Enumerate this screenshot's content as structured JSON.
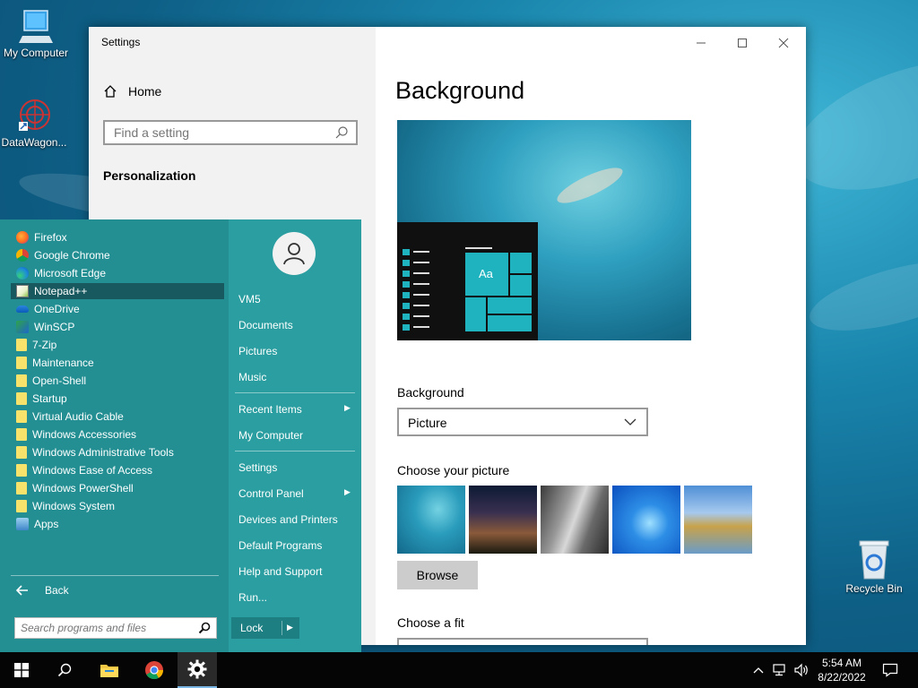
{
  "desktop": {
    "icons": [
      {
        "label": "My Computer"
      },
      {
        "label": "DataWagon..."
      },
      {
        "label": "Recycle Bin"
      }
    ]
  },
  "settings": {
    "window_title": "Settings",
    "home_label": "Home",
    "search_placeholder": "Find a setting",
    "section_title": "Personalization",
    "page_title": "Background",
    "background_label": "Background",
    "background_value": "Picture",
    "choose_picture_label": "Choose your picture",
    "browse_label": "Browse",
    "choose_fit_label": "Choose a fit",
    "preview_sample_text": "Aa"
  },
  "start_menu": {
    "programs": [
      {
        "label": "Firefox",
        "icon": "firefox-icon"
      },
      {
        "label": "Google Chrome",
        "icon": "chrome-icon"
      },
      {
        "label": "Microsoft Edge",
        "icon": "edge-icon"
      },
      {
        "label": "Notepad++",
        "icon": "notepadpp-icon"
      },
      {
        "label": "OneDrive",
        "icon": "onedrive-icon"
      },
      {
        "label": "WinSCP",
        "icon": "winscp-icon"
      },
      {
        "label": "7-Zip",
        "icon": "folder-icon"
      },
      {
        "label": "Maintenance",
        "icon": "folder-icon"
      },
      {
        "label": "Open-Shell",
        "icon": "folder-icon"
      },
      {
        "label": "Startup",
        "icon": "folder-icon"
      },
      {
        "label": "Virtual Audio Cable",
        "icon": "folder-icon"
      },
      {
        "label": "Windows Accessories",
        "icon": "folder-icon"
      },
      {
        "label": "Windows Administrative Tools",
        "icon": "folder-icon"
      },
      {
        "label": "Windows Ease of Access",
        "icon": "folder-icon"
      },
      {
        "label": "Windows PowerShell",
        "icon": "folder-icon"
      },
      {
        "label": "Windows System",
        "icon": "folder-icon"
      },
      {
        "label": "Apps",
        "icon": "apps-icon"
      }
    ],
    "selected_program": "Notepad++",
    "back_label": "Back",
    "search_placeholder": "Search programs and files",
    "links": {
      "user": "VM5",
      "documents": "Documents",
      "pictures": "Pictures",
      "music": "Music",
      "recent_items": "Recent Items",
      "my_computer": "My Computer",
      "settings": "Settings",
      "control_panel": "Control Panel",
      "devices_printers": "Devices and Printers",
      "default_programs": "Default Programs",
      "help_support": "Help and Support",
      "run": "Run..."
    },
    "lock_label": "Lock"
  },
  "taskbar": {
    "time": "5:54 AM",
    "date": "8/22/2022"
  },
  "colors": {
    "start_menu_bg": "#238f93",
    "accent_tile": "#1fb3bf",
    "taskbar_bg": "#050505"
  }
}
